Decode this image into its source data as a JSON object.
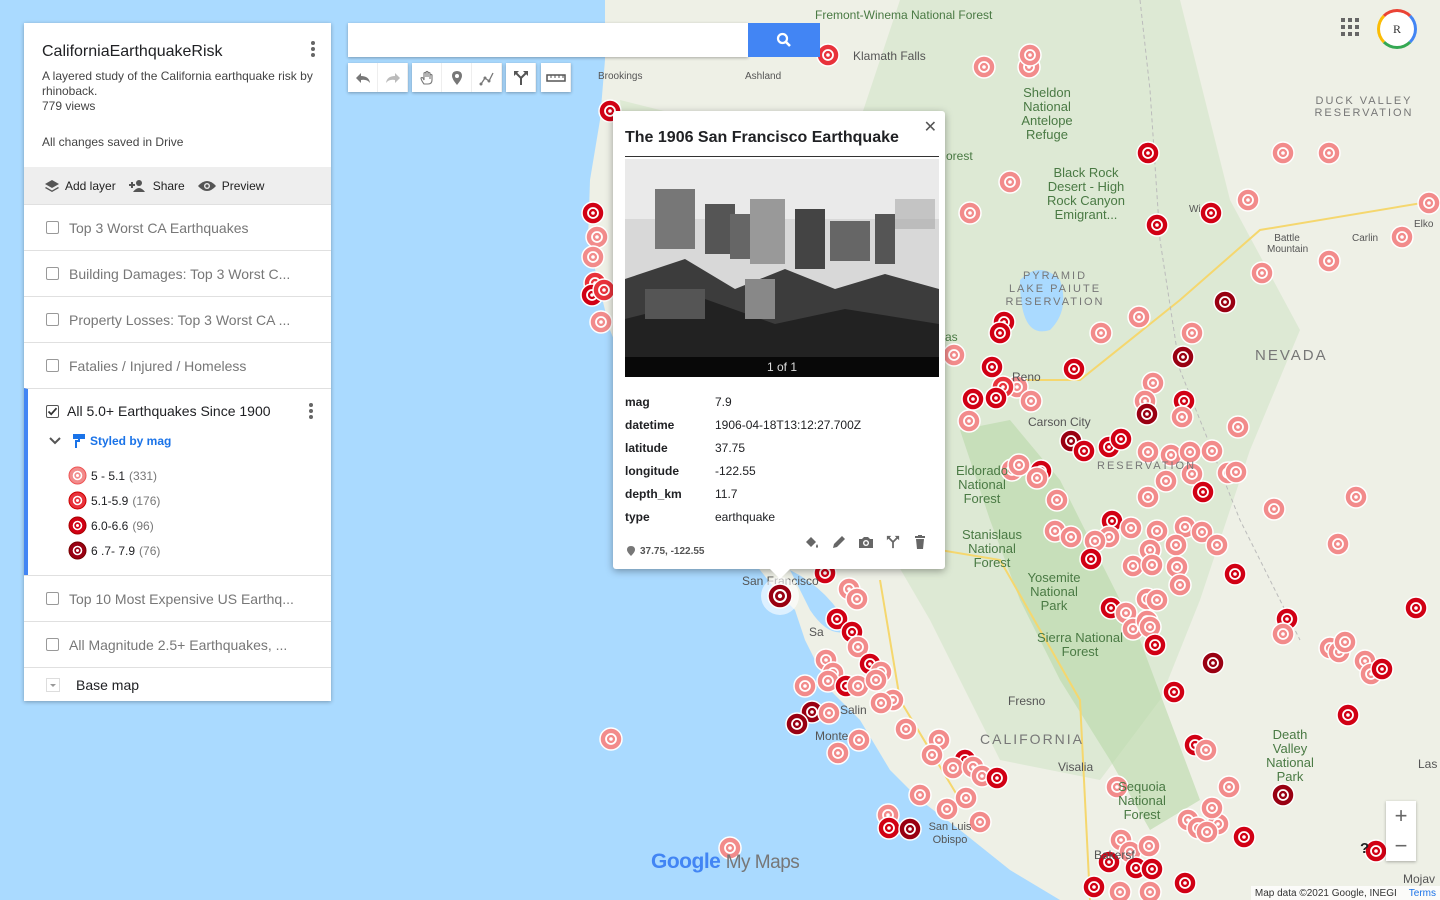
{
  "sidebar": {
    "title": "CaliforniaEarthquakeRisk",
    "description": "A layered study of the California earthquake risk by rhinoback.",
    "views": "779 views",
    "saved": "All changes saved in Drive",
    "toolbar": {
      "add_layer": "Add layer",
      "share": "Share",
      "preview": "Preview"
    },
    "layers": [
      {
        "label": "Top 3 Worst CA Earthquakes"
      },
      {
        "label": "Building Damages: Top 3 Worst C..."
      },
      {
        "label": "Property Losses: Top 3 Worst CA ..."
      },
      {
        "label": "Fatalies / Injured / Homeless"
      }
    ],
    "active_layer": {
      "label": "All 5.0+ Earthquakes Since 1900",
      "styled_by": "Styled by mag",
      "legend": [
        {
          "label": "5 - 5.1",
          "count": "(331)",
          "color": "#f28b8b"
        },
        {
          "label": "5.1-5.9",
          "count": "(176)",
          "color": "#e8323b"
        },
        {
          "label": "6.0-6.6",
          "count": "(96)",
          "color": "#d10014"
        },
        {
          "label": "6 .7- 7.9",
          "count": "(76)",
          "color": "#990012"
        }
      ]
    },
    "layers_after": [
      {
        "label": "Top 10 Most Expensive US Earthq..."
      },
      {
        "label": "All Magnitude 2.5+ Earthquakes, ..."
      }
    ],
    "base_map": "Base map"
  },
  "search": {
    "placeholder": ""
  },
  "popup": {
    "title": "The 1906 San Francisco Earthquake",
    "photo_count": "1 of 1",
    "attributes": [
      {
        "key": "mag",
        "value": "7.9"
      },
      {
        "key": "datetime",
        "value": "1906-04-18T13:12:27.700Z"
      },
      {
        "key": "latitude",
        "value": "37.75"
      },
      {
        "key": "longitude",
        "value": "-122.55"
      },
      {
        "key": "depth_km",
        "value": "11.7"
      },
      {
        "key": "type",
        "value": "earthquake"
      }
    ],
    "coords": "37.75, -122.55"
  },
  "map_labels": {
    "fremont": "Fremont-Winema National Forest",
    "sheldon": "Sheldon National Antelope Refuge",
    "duck": "DUCK VALLEY RESERVATION",
    "blackrock": "Black Rock Desert - High Rock Canyon Emigrant...",
    "pyramid": "PYRAMID LAKE PAIUTE RESERVATION",
    "nevada": "NEVADA",
    "california": "CALIFORNIA",
    "fresno": "Fresno",
    "reno": "Reno",
    "carson": "Carson City",
    "eldorado": "Eldorado National Forest",
    "stanislaus": "Stanislaus National Forest",
    "yosemite": "Yosemite National Park",
    "sierra": "Sierra National Forest",
    "deathvalley": "Death Valley National Park",
    "sequoia": "Sequoia National Forest",
    "visalia": "Visalia",
    "bakersfield": "Bakersf",
    "slo": "San Luis Obispo",
    "monterey": "Monte",
    "salinas": "Salin",
    "sanjose": "Sa",
    "sf": "San Francisco",
    "brookings": "Brookings",
    "ashland": "Ashland",
    "klamath": "Klamath Falls",
    "battle": "Battle Mountain",
    "carlin": "Carlin",
    "elko": "Elko",
    "winnemucca": "Wi",
    "lasvegas": "Las",
    "mojave": "Mojav",
    "forest": "orest",
    "reservation": "RESERVATION",
    "national_forest_left": "as"
  },
  "map_ui": {
    "logo_google": "Google",
    "logo_mymaps": "My Maps",
    "attribution": "Map data ©2021 Google, INEGI",
    "terms": "Terms",
    "zoom_in": "+",
    "zoom_out": "−",
    "help": "?",
    "avatar": "R"
  },
  "colors": {
    "accent": "#4285f4",
    "water": "#aadaff",
    "land": "#eef0e6"
  }
}
